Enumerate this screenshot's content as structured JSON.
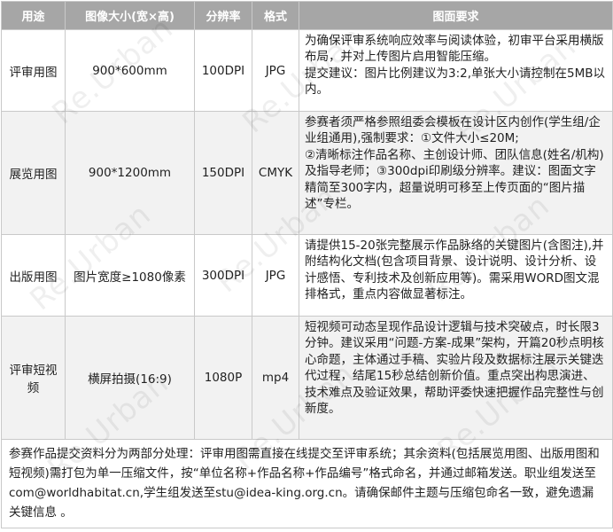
{
  "header": {
    "col_use": "用途",
    "col_size": "图像大小(宽×高)",
    "col_res": "分辨率",
    "col_format": "格式",
    "col_req": "图面要求"
  },
  "rows": [
    {
      "use": "评审用图",
      "size": "900*600mm",
      "res": "100DPI",
      "format": "JPG",
      "req": "为确保评审系统响应效率与阅读体验，初审平台采用横版布局，并对上传图片启用智能压缩。\n提交建议：图片比例建议为3:2,单张大小请控制在5MB以内。"
    },
    {
      "use": "展览用图",
      "size": "900*1200mm",
      "res": "150DPI",
      "format": "CMYK",
      "req": "参赛者须严格参照组委会模板在设计区内创作(学生组/企业组通用),强制要求：①文件大小≤20M;\n②清晰标注作品名称、主创设计师、团队信息(姓名/机构)及指导老师；③300dpi印刷级分辨率。建议：图面文字精简至300字内，超量说明可移至上传页面的“图片描述”专栏。"
    },
    {
      "use": "出版用图",
      "size": "图片宽度≥1080像素",
      "res": "300DPI",
      "format": "JPG",
      "req": "请提供15-20张完整展示作品脉络的关键图片(含图注),并附结构化文档(包含项目背景、设计说明、设计分析、设计感悟、专利技术及创新应用等)。需采用WORD图文混排格式，重点内容做显著标注。"
    },
    {
      "use": "评审短视频",
      "size": "横屏拍摄(16:9)",
      "res": "1080P",
      "format": "mp4",
      "req": "短视频可动态呈现作品设计逻辑与技术突破点，时长限3分钟。建议采用“问题-方案-成果”架构，开篇20秒点明核心命题，主体通过手稿、实验片段及数据标注展示关键迭代过程，结尾15秒总结创新价值。重点突出构思演进、技术难点及验证效果，帮助评委快速把握作品完整性与创新度。"
    }
  ],
  "footer": "参赛作品提交资料分为两部分处理：评审用图需直接在线提交至评审系统；其余资料(包括展览用图、出版用图和短视频)需打包为单一压缩文件，按“单位名称+作品名称+作品编号”格式命名，并通过邮箱发送。职业组发送至com@worldhabitat.cn,学生组发送至stu@idea-king.org.cn。请确保邮件主题与压缩包命名一致，避免遗漏关键信息 。",
  "watermark": "Re.Urban",
  "colors": {
    "header_bg": "#a6a6a6",
    "alt_row_bg": "#f2f2f2",
    "border": "#c9c9c9"
  }
}
